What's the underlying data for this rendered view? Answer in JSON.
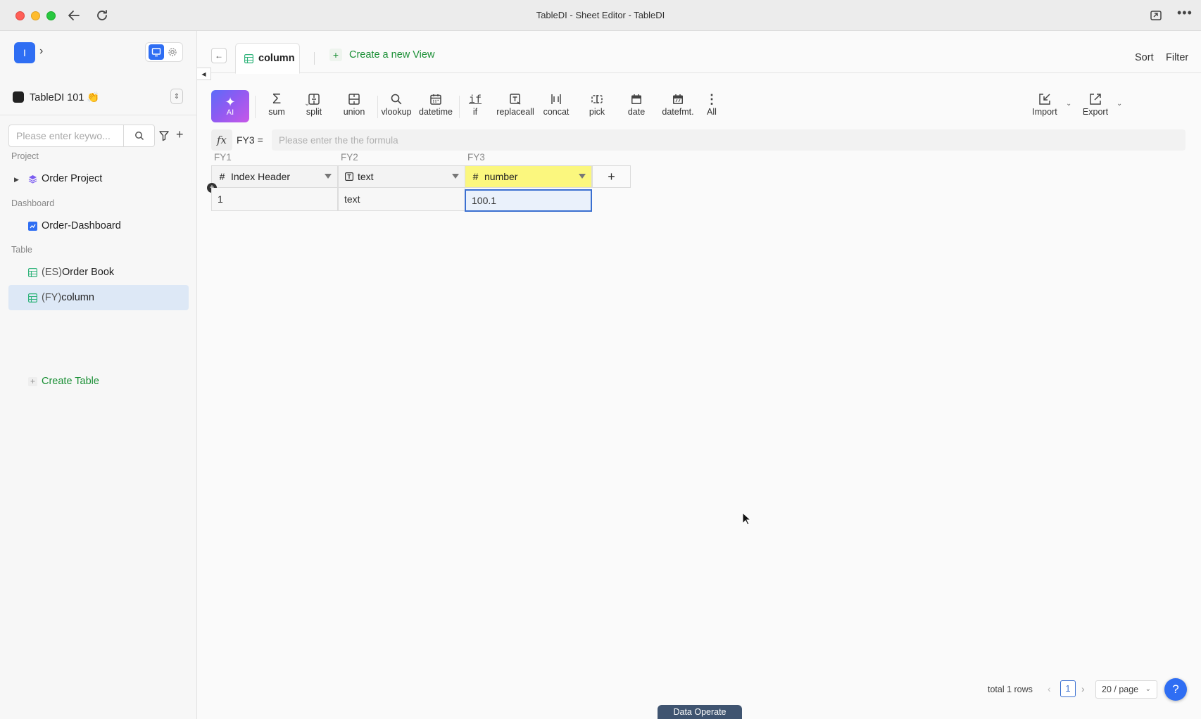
{
  "window": {
    "title": "TableDI - Sheet Editor - TableDI"
  },
  "sidebar": {
    "app_logo_letter": "I",
    "workspace_name": "TableDI 101 👏",
    "search": {
      "placeholder": "Please enter keywo..."
    },
    "sections": {
      "project": "Project",
      "dashboard": "Dashboard",
      "table": "Table"
    },
    "items": {
      "order_project": "Order Project",
      "order_dashboard": "Order-Dashboard",
      "order_book_prefix": "(ES)",
      "order_book": "Order Book",
      "column_prefix": "(FY)",
      "column": "column",
      "create_table": "Create Table"
    }
  },
  "topbar": {
    "view_tab": "column",
    "create_view": "Create a new View",
    "sort": "Sort",
    "filter": "Filter"
  },
  "toolbar": {
    "ai": "AI",
    "tools": {
      "sum": "sum",
      "split": "split",
      "union": "union",
      "vlookup": "vlookup",
      "datetime": "datetime",
      "if": "if",
      "replaceall": "replaceall",
      "concat": "concat",
      "pick": "pick",
      "date": "date",
      "datefmt": "datefmt.",
      "all": "All",
      "import": "Import",
      "export": "Export"
    }
  },
  "formula": {
    "cell_ref": "FY3 =",
    "placeholder": "Please enter the the formula"
  },
  "grid": {
    "columns": [
      {
        "code": "FY1",
        "name": "Index Header",
        "type_icon": "#"
      },
      {
        "code": "FY2",
        "name": "text",
        "type_icon": "T"
      },
      {
        "code": "FY3",
        "name": "number",
        "type_icon": "#"
      }
    ],
    "rows": [
      [
        "1",
        "text",
        "100.1"
      ]
    ],
    "add_column": "+"
  },
  "footer": {
    "total": "total 1 rows",
    "page": "1",
    "page_size": "20 / page",
    "help": "?",
    "data_operate": "Data Operate"
  },
  "colors": {
    "accent": "#2f6ef3",
    "green": "#1a8f35",
    "highlight_header": "#fbf77e",
    "selection": "#3a6fd0"
  }
}
